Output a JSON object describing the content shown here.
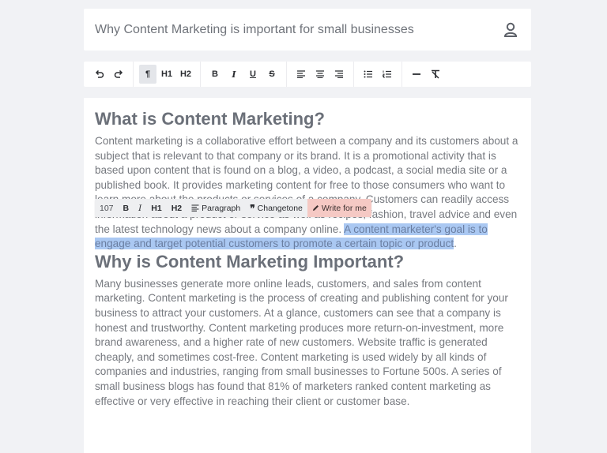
{
  "document": {
    "title": "Why Content Marketing is important for small businesses"
  },
  "toolbar": {
    "undo_icon": "undo-icon",
    "redo_icon": "redo-icon",
    "paragraph_glyph": "¶",
    "h1_label": "H1",
    "h2_label": "H2",
    "bold_label": "B",
    "italic_label": "I",
    "underline_label": "U",
    "strike_label": "S"
  },
  "floating_toolbar": {
    "word_count": "107",
    "bold_label": "B",
    "italic_label": "I",
    "h1_label": "H1",
    "h2_label": "H2",
    "paragraph_label": "Paragraph",
    "changetone_label": "Changetone",
    "write_label": "Write for me"
  },
  "content": {
    "section1": {
      "heading": "What is Content Marketing?",
      "paragraph": "Content marketing is a collaborative effort between a company and its customers about a subject that is relevant to that company or its brand. It is a promotional activity that is based upon content that is found on a blog, a video, a podcast, a social media site or a published book. It provides marketing content for free to those consumers who want to learn more about the products or services of a company. Customers can readily access information about a product or service as well as recipes, fashion, travel advice and even the latest technology news about a company online. ",
      "highlighted": "A content marketer's goal is to engage and target potential customers to promote a certain topic or product",
      "after": "."
    },
    "section2": {
      "heading": "Why is Content Marketing Important?",
      "paragraph": "Many businesses generate more online leads, customers, and sales from content marketing. Content marketing is the process of creating and publishing content for your business to attract your customers. At a glance, customers can see that a company is honest and trustworthy. Content marketing produces more return-on-investment, more brand awareness, and a higher rate of new customers.  Website traffic is generated cheaply, and sometimes cost-free. Content marketing is used widely by all kinds of companies and industries, ranging from small businesses to Fortune 500s.  A series of small business blogs has found that 81% of marketers ranked content marketing as effective or very effective in reaching their client or customer base."
    }
  }
}
